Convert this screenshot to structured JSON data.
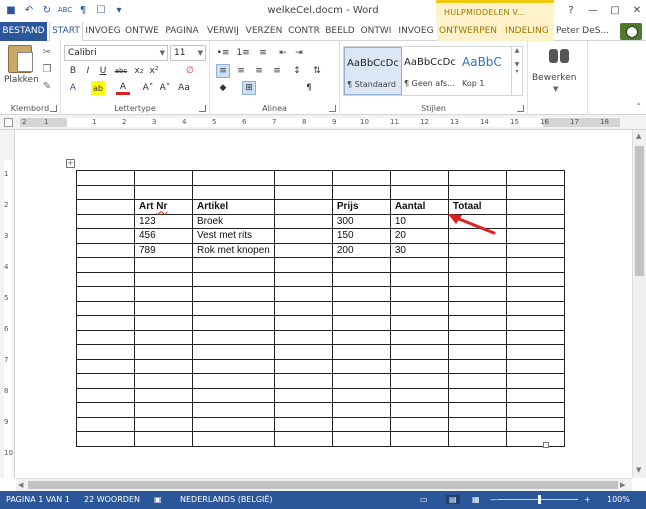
{
  "window": {
    "title": "welkeCel.docm - Word",
    "contextual_header": "HULPMIDDELEN V...",
    "help": "?",
    "minimize": "—",
    "restore": "□",
    "close": "✕"
  },
  "qat": {
    "save": "■",
    "undo": "↶",
    "redo": "↻",
    "spelling": "ABC",
    "pilcrow": "¶",
    "checkbox": "☐",
    "customize": "▾"
  },
  "tabs": [
    "BESTAND",
    "START",
    "INVOEG",
    "ONTWE",
    "PAGINA",
    "VERWIJ",
    "VERZEN",
    "CONTR",
    "BEELD",
    "ONTWI",
    "INVOEG",
    "ONTWERPEN",
    "INDELING"
  ],
  "user": "Peter DeS...",
  "ribbon": {
    "clipboard": {
      "label": "Klembord",
      "paste": "Plakken"
    },
    "font": {
      "label": "Lettertype",
      "name": "Calibri",
      "size": "11",
      "grow": "A˄",
      "shrink": "A˅",
      "case": "Aa",
      "clear": "∅",
      "bold": "B",
      "italic": "I",
      "underline": "U",
      "strike": "abc",
      "sub": "x₂",
      "sup": "x²",
      "effects": "A",
      "highlight": "ab",
      "color": "A"
    },
    "paragraph": {
      "label": "Alinea",
      "bullets": "•≡",
      "numbering": "1≡",
      "multilevel": "≡",
      "decrease_indent": "⇤",
      "increase_indent": "⇥",
      "sort": "⇅",
      "pilcrow": "¶",
      "left": "≡",
      "center": "≡",
      "right": "≡",
      "justify": "≡",
      "line_spacing": "↕",
      "shading": "◆",
      "borders": "⊞"
    },
    "styles": {
      "label": "Stijlen",
      "items": [
        {
          "sample": "AaBbCcDc",
          "name": "¶ Standaard"
        },
        {
          "sample": "AaBbCcDc",
          "name": "¶ Geen afs..."
        },
        {
          "sample": "AaBbC",
          "name": "Kop 1"
        }
      ]
    },
    "editing": {
      "label": "Bewerken"
    }
  },
  "ruler": {
    "h_numbers": [
      "2",
      "1",
      "1",
      "2",
      "3",
      "4",
      "5",
      "6",
      "7",
      "8",
      "9",
      "10",
      "11",
      "12",
      "13",
      "14",
      "15",
      "16",
      "17",
      "18"
    ],
    "v_numbers": [
      "1",
      "2",
      "3",
      "4",
      "5",
      "6",
      "7",
      "8",
      "9",
      "10"
    ]
  },
  "table": {
    "rows": [
      [
        "",
        "",
        "",
        "",
        "",
        "",
        "",
        ""
      ],
      [
        "",
        "",
        "",
        "",
        "",
        "",
        "",
        ""
      ],
      [
        "",
        "Art Nr",
        "Artikel",
        "",
        "Prijs",
        "Aantal",
        "Totaal",
        ""
      ],
      [
        "",
        "123",
        "Broek",
        "",
        "300",
        "10",
        "",
        ""
      ],
      [
        "",
        "456",
        "Vest met rits",
        "",
        "150",
        "20",
        "",
        ""
      ],
      [
        "",
        "789",
        "Rok met knopen",
        "",
        "200",
        "30",
        "",
        ""
      ],
      [
        "",
        "",
        "",
        "",
        "",
        "",
        "",
        ""
      ],
      [
        "",
        "",
        "",
        "",
        "",
        "",
        "",
        ""
      ],
      [
        "",
        "",
        "",
        "",
        "",
        "",
        "",
        ""
      ],
      [
        "",
        "",
        "",
        "",
        "",
        "",
        "",
        ""
      ],
      [
        "",
        "",
        "",
        "",
        "",
        "",
        "",
        ""
      ],
      [
        "",
        "",
        "",
        "",
        "",
        "",
        "",
        ""
      ],
      [
        "",
        "",
        "",
        "",
        "",
        "",
        "",
        ""
      ],
      [
        "",
        "",
        "",
        "",
        "",
        "",
        "",
        ""
      ],
      [
        "",
        "",
        "",
        "",
        "",
        "",
        "",
        ""
      ],
      [
        "",
        "",
        "",
        "",
        "",
        "",
        "",
        ""
      ],
      [
        "",
        "",
        "",
        "",
        "",
        "",
        "",
        ""
      ],
      [
        "",
        "",
        "",
        "",
        "",
        "",
        "",
        ""
      ],
      [
        "",
        "",
        "",
        "",
        "",
        "",
        "",
        ""
      ]
    ],
    "handle": "+"
  },
  "statusbar": {
    "page": "PAGINA 1 VAN 1",
    "words": "22 WOORDEN",
    "proofing": "▣",
    "language": "NEDERLANDS (BELGIË)",
    "zoom_out": "—",
    "zoom_in": "+",
    "zoom": "100%"
  },
  "colors": {
    "accent": "#2b579a",
    "context": "#fdf2c9",
    "arrow": "#e02020"
  }
}
